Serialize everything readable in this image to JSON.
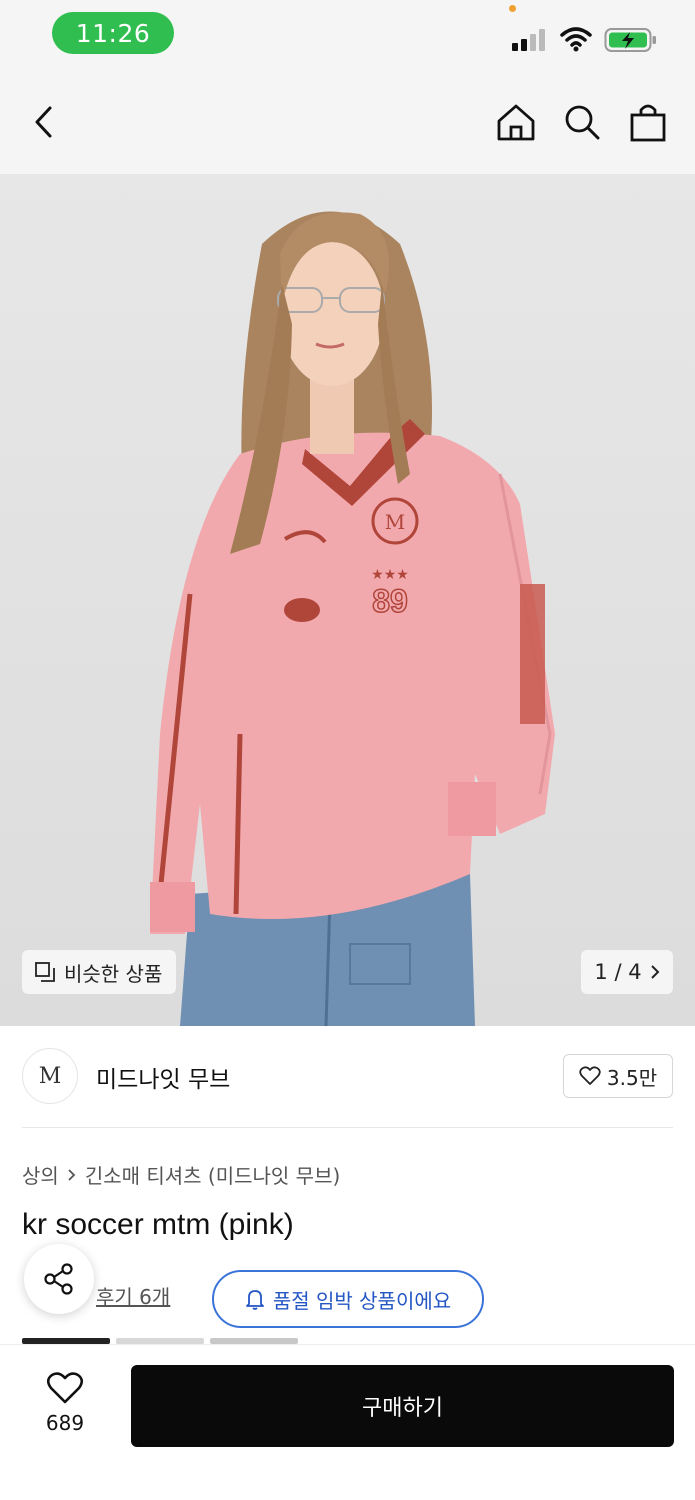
{
  "status_bar": {
    "time": "11:26"
  },
  "nav": {
    "icons": [
      "chevron-left-icon",
      "home-icon",
      "search-icon",
      "shopping-bag-icon"
    ]
  },
  "hero": {
    "similar_label": "비슷한 상품",
    "page_indicator": "1 / 4",
    "image_desc_icon": "product-photo",
    "jersey_number": "89"
  },
  "brand": {
    "logo_text": "M",
    "name": "미드나잇 무브",
    "likes": "3.5만"
  },
  "product": {
    "breadcrumb_category": "상의",
    "breadcrumb_sub": "긴소매 티셔츠 (미드나잇 무브)",
    "title": "kr soccer mtm (pink)",
    "review_link": "후기 6개",
    "soldout_notice": "품절 임박 상품이에요"
  },
  "bottom": {
    "wish_count": "689",
    "buy_label": "구매하기"
  },
  "colors": {
    "status_pill": "#2fbe4f",
    "accent_blue": "#3b73d9",
    "buy_button": "#0a0a0a",
    "jersey_pink": "#f2a9ad",
    "jersey_trim": "#b0453a"
  }
}
